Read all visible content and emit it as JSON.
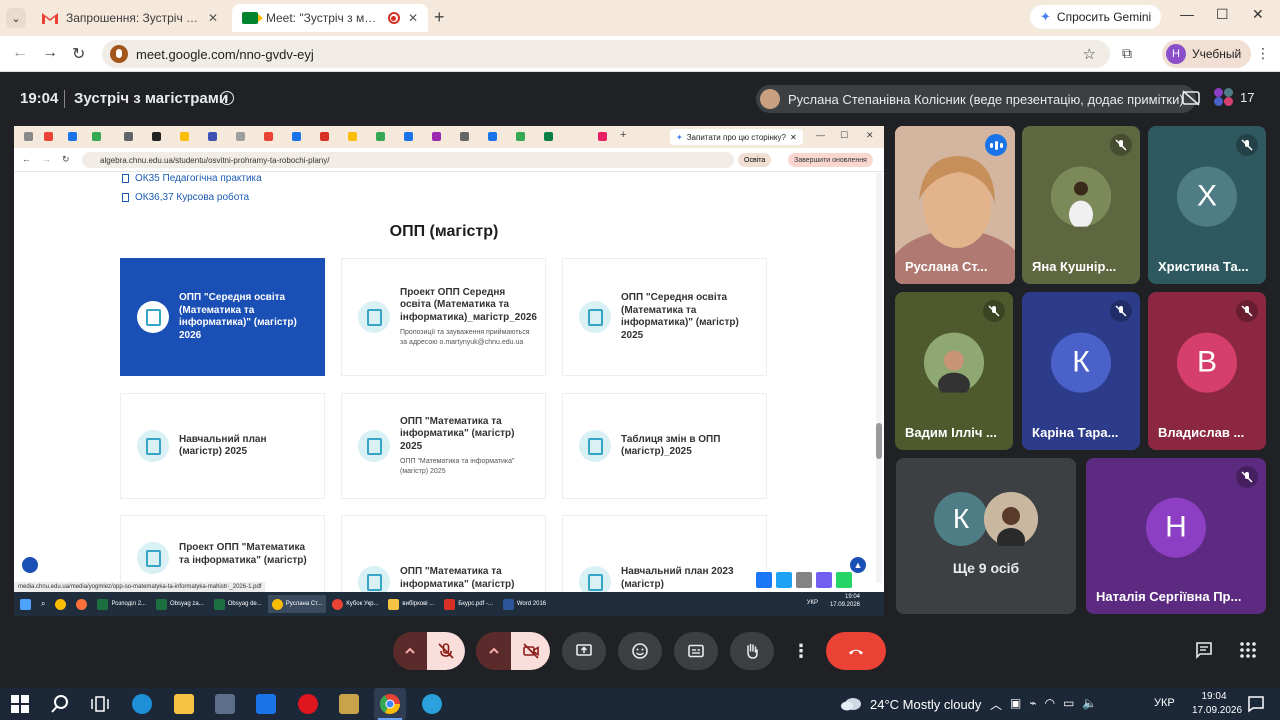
{
  "browser": {
    "tabs": [
      {
        "label": "Запрошення: Зустріч з магістр"
      },
      {
        "label": "Meet: \"Зустріч з магістрами\""
      }
    ],
    "gemini_label": "Спросить Gemini",
    "url": "meet.google.com/nno-gvdv-eyj",
    "profile_label": "Учебный",
    "profile_initial": "Н"
  },
  "meet": {
    "time": "19:04",
    "title": "Зустріч з магістрами",
    "presenter": "Руслана Степанівна Колісник (веде презентацію, додає примітки)",
    "participants_count": "17"
  },
  "shared": {
    "gemini_label": "Запитати про цю сторінку?",
    "url": "algebra.chnu.edu.ua/studentu/osvitni-prohramy-ta-robochi-plany/",
    "osvita_label": "Освіта",
    "update_label": "Завершити оновлення",
    "links": [
      "ОК35 Педагогічна практика",
      "ОК36,37 Курсова робота"
    ],
    "section_title": "ОПП (магістр)",
    "cards": [
      {
        "title": "ОПП \"Середня освіта (Математика та інформатика)\" (магістр) 2026",
        "sub": ""
      },
      {
        "title": "Проект ОПП Середня освіта (Математика та інформатика)_магістр_2026",
        "sub": "Пропозиції та зауваження приймаються за адресою o.martynyuk@chnu.edu.ua"
      },
      {
        "title": "ОПП \"Середня освіта (Математика та інформатика)\" (магістр) 2025",
        "sub": ""
      },
      {
        "title": "Навчальний план (магістр) 2025",
        "sub": ""
      },
      {
        "title": "ОПП \"Математика та інформатика\" (магістр) 2025",
        "sub": "ОПП \"Математика та інформатика\" (магістр) 2025"
      },
      {
        "title": "Таблиця змін в ОПП (магістр)_2025",
        "sub": ""
      },
      {
        "title": "Проект ОПП \"Математика та інформатика\" (магістр)",
        "sub": ""
      },
      {
        "title": "ОПП \"Математика та інформатика\" (магістр)",
        "sub": ""
      },
      {
        "title": "Навчальний план 2023 (магістр)",
        "sub": ""
      }
    ],
    "status_url": "media.chnu.edu.ua/media/yogmlez/opp-so-matematyka-ta-informatyka-mahistr-_2026-1.pdf",
    "taskbar_items": [
      "Розподіл 2...",
      "Obsyag za...",
      "Obsyag de...",
      "Руслана Ст...",
      "Кубок Укр...",
      "вибіркові ...",
      "Бкурс.pdf -...",
      "Word 2016"
    ],
    "taskbar_lang": "УКР",
    "taskbar_time": "19:04",
    "taskbar_date": "17.09.2026"
  },
  "participants": [
    {
      "name": "Руслана Ст...",
      "initial": "",
      "color": "#c7a58f"
    },
    {
      "name": "Яна Кушнір...",
      "initial": "",
      "color": "#6f7a4a"
    },
    {
      "name": "Христина Та...",
      "initial": "Х",
      "color": "#4f7d86"
    },
    {
      "name": "Вадим Ілліч ...",
      "initial": "",
      "color": "#7a8a5a"
    },
    {
      "name": "Каріна Тара...",
      "initial": "К",
      "color": "#4a61c9"
    },
    {
      "name": "Владислав ...",
      "initial": "В",
      "color": "#d63f6d"
    },
    {
      "name": "Наталія Сергіївна Пр...",
      "initial": "Н",
      "color": "#8d3fc4"
    }
  ],
  "more_tile": {
    "label": "Ще 9 осіб",
    "initial": "К"
  },
  "taskbar": {
    "weather": "24°C  Mostly cloudy",
    "lang": "УКР",
    "time": "19:04",
    "date": "17.09.2026"
  }
}
